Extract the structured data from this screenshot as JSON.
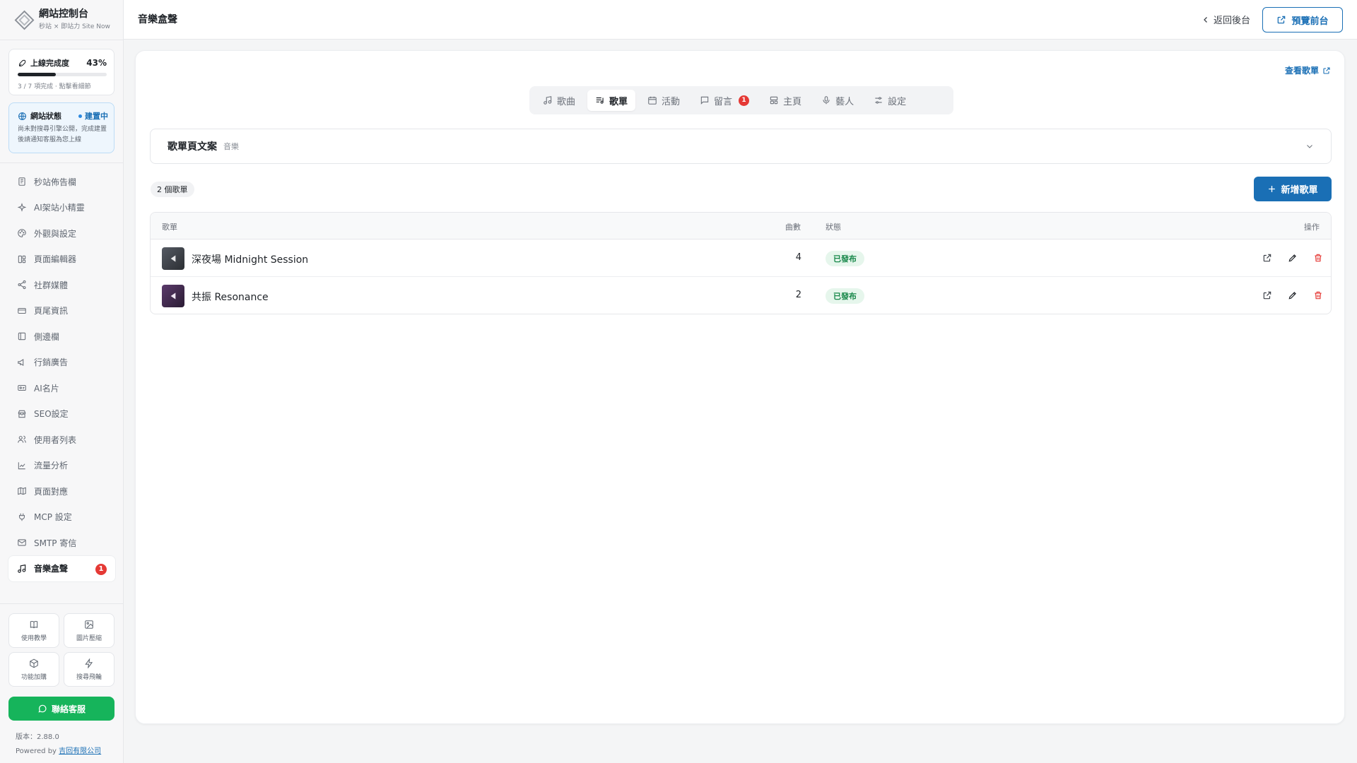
{
  "sidebar": {
    "brand_title": "網站控制台",
    "brand_subtitle": "秒站 × 即站力 Site Now",
    "progress": {
      "label": "上線完成度",
      "percent_text": "43%",
      "percent": 43,
      "note": "3 / 7 項完成 · 點擊看細節"
    },
    "site_status": {
      "label": "網站狀態",
      "status": "建置中",
      "note": "尚未對搜尋引擎公開，完成建置後請通知客服為您上線"
    },
    "nav": [
      {
        "label": "秒站佈告欄",
        "icon": "notebook-icon"
      },
      {
        "label": "AI架站小精靈",
        "icon": "sparkles-icon"
      },
      {
        "label": "外觀與設定",
        "icon": "palette-icon"
      },
      {
        "label": "頁面編輯器",
        "icon": "layout-icon"
      },
      {
        "label": "社群媒體",
        "icon": "share-icon"
      },
      {
        "label": "頁尾資訊",
        "icon": "card-icon"
      },
      {
        "label": "側邊欄",
        "icon": "sidebar-icon"
      },
      {
        "label": "行銷廣告",
        "icon": "megaphone-icon"
      },
      {
        "label": "AI名片",
        "icon": "id-card-icon"
      },
      {
        "label": "SEO設定",
        "icon": "store-icon"
      },
      {
        "label": "使用者列表",
        "icon": "users-icon"
      },
      {
        "label": "流量分析",
        "icon": "chart-line-icon"
      },
      {
        "label": "頁面對應",
        "icon": "map-icon"
      },
      {
        "label": "MCP 設定",
        "icon": "plug-icon"
      },
      {
        "label": "SMTP 寄信",
        "icon": "mail-icon"
      },
      {
        "label": "音樂盒聲",
        "icon": "music-icon",
        "badge": "1"
      }
    ],
    "tools": [
      {
        "label": "使用教學",
        "icon": "book-icon"
      },
      {
        "label": "圖片壓縮",
        "icon": "image-icon"
      },
      {
        "label": "功能加購",
        "icon": "box-icon"
      },
      {
        "label": "搜尋飛輪",
        "icon": "bolt-icon"
      }
    ],
    "contact_label": "聯絡客服",
    "version": "版本：2.88.0",
    "powered_prefix": "Powered by",
    "powered_company": "吉回有限公司"
  },
  "header": {
    "title": "音樂盒聲",
    "back_label": "返回後台",
    "preview_label": "預覽前台"
  },
  "main": {
    "view_link": "查看歌單",
    "tabs": [
      {
        "label": "歌曲",
        "icon": "music-note-icon"
      },
      {
        "label": "歌單",
        "icon": "list-music-icon",
        "active": true
      },
      {
        "label": "活動",
        "icon": "calendar-icon"
      },
      {
        "label": "留言",
        "icon": "message-icon",
        "badge": "1"
      },
      {
        "label": "主頁",
        "icon": "layout-icon"
      },
      {
        "label": "藝人",
        "icon": "mic-icon"
      },
      {
        "label": "設定",
        "icon": "sliders-icon"
      }
    ],
    "section_title": "歌單頁文案",
    "section_subtitle": "音樂",
    "count_label": "2 個歌單",
    "add_label": "新增歌單",
    "table": {
      "headers": {
        "name": "歌單",
        "count": "曲數",
        "status": "狀態",
        "actions": "操作"
      },
      "rows": [
        {
          "name": "深夜場 Midnight Session",
          "count": "4",
          "status": "已發布",
          "cover": "gray"
        },
        {
          "name": "共振 Resonance",
          "count": "2",
          "status": "已發布",
          "cover": "purple"
        }
      ]
    }
  },
  "colors": {
    "accent": "#1a6fb5",
    "success": "#16b45b",
    "danger": "#e53935"
  }
}
